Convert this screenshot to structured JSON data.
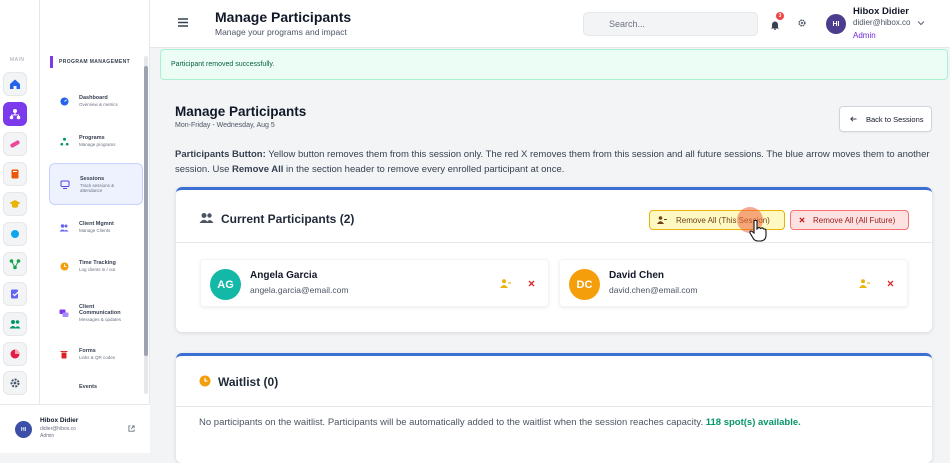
{
  "sidebar": {
    "section_label": "MAIN",
    "program_label": "PROGRAM MANAGEMENT",
    "items": [
      {
        "title": "Dashboard",
        "sub": "Overview & metrics"
      },
      {
        "title": "Programs",
        "sub": "Manage programs"
      },
      {
        "title": "Sessions",
        "sub": "Track sessions & attendance"
      },
      {
        "title": "Client Mgmnt",
        "sub": "Manage Clients"
      },
      {
        "title": "Time Tracking",
        "sub": "Log clients in / out"
      },
      {
        "title": "Client Communication",
        "sub": "Messages & updates"
      },
      {
        "title": "Forms",
        "sub": "Links & QR codes"
      },
      {
        "title": "Events",
        "sub": ""
      }
    ],
    "user": {
      "initials": "HI",
      "name": "Hibox Didier",
      "email": "didier@hibox.co",
      "role": "Admin"
    }
  },
  "header": {
    "title": "Manage Participants",
    "subtitle": "Manage your programs and impact",
    "search_placeholder": "Search...",
    "notif_count": "3",
    "user": {
      "initials": "HI",
      "name": "Hibox Didier",
      "email": "didier@hibox.co",
      "role": "Admin"
    }
  },
  "alert": "Participant removed successfully.",
  "page": {
    "title": "Manage Participants",
    "date": "Mon-Friday - Wednesday, Aug 5",
    "back_label": "Back to Sessions",
    "help_bold": "Participants Button:",
    "help_1": " Yellow button removes them from this session only. The red X removes them from this session and all future sessions. The blue arrow moves them to another session. Use ",
    "help_bold2": "Remove All",
    "help_2": " in the section header to remove every enrolled participant at once."
  },
  "current": {
    "title": "Current Participants (2)",
    "remove_session": "Remove All (This Session)",
    "remove_future": "Remove All (All Future)",
    "participants": [
      {
        "initials": "AG",
        "name": "Angela Garcia",
        "email": "angela.garcia@email.com",
        "color": "#14b8a6"
      },
      {
        "initials": "DC",
        "name": "David Chen",
        "email": "david.chen@email.com",
        "color": "#f59e0b"
      }
    ]
  },
  "waitlist": {
    "title": "Waitlist (0)",
    "message": "No participants on the waitlist. Participants will be automatically added to the waitlist when the session reaches capacity.",
    "spots": "118 spot(s) available."
  },
  "colors": {
    "accent": "#7c3aed",
    "green": "#059669",
    "blue": "#3b6fd4",
    "danger": "#dc2626",
    "warn": "#eab308"
  }
}
